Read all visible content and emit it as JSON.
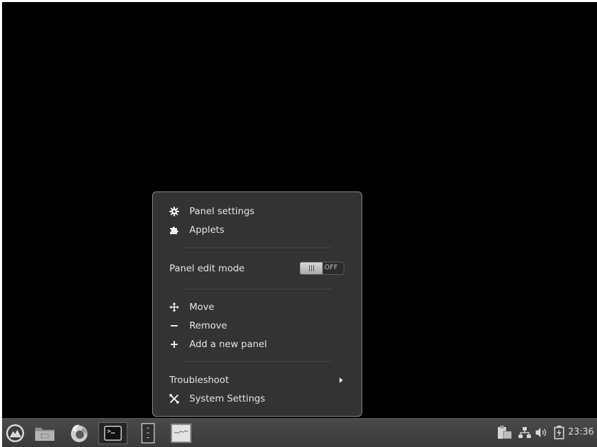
{
  "menu": {
    "panel_settings": "Panel settings",
    "applets": "Applets",
    "panel_edit_mode": "Panel edit mode",
    "toggle_state": "OFF",
    "move": "Move",
    "remove": "Remove",
    "add_panel": "Add a new panel",
    "troubleshoot": "Troubleshoot",
    "system_settings": "System Settings"
  },
  "taskbar": {
    "launchers": [
      "menu-icon",
      "files-icon",
      "firefox-icon",
      "terminal-icon",
      "text-editor-icon",
      "notes-icon"
    ],
    "tray": [
      "clipboard-icon",
      "network-icon",
      "volume-icon",
      "battery-icon"
    ],
    "clock": "23:36"
  },
  "colors": {
    "desktop": "#000000",
    "menu_bg": "#333333",
    "taskbar_bg": "#444444"
  }
}
